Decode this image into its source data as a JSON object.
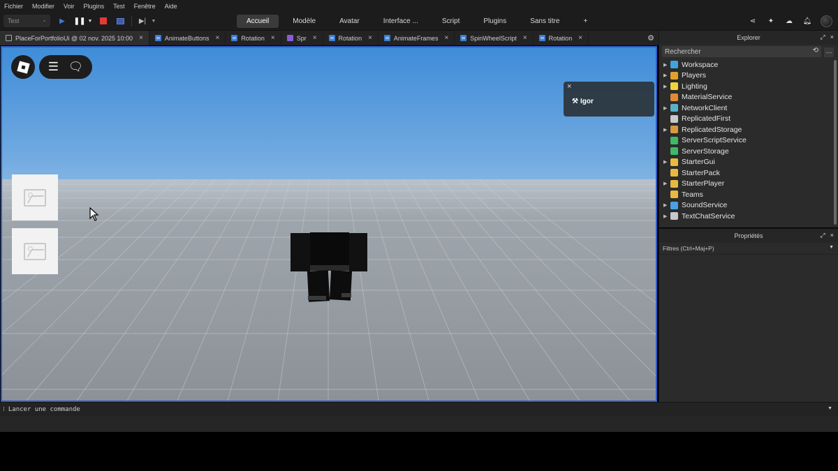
{
  "menubar": [
    "Fichier",
    "Modifier",
    "Voir",
    "Plugins",
    "Test",
    "Fenêtre",
    "Aide"
  ],
  "toolbar": {
    "mode": "Test",
    "tabs": [
      "Accueil",
      "Modèle",
      "Avatar",
      "Interface ...",
      "Script",
      "Plugins",
      "Sans titre",
      "+"
    ],
    "active_tab": "Accueil"
  },
  "doc_tabs": [
    {
      "label": "PlaceForPortfolioUi @ 02 nov. 2025 10:00",
      "icon": "place-icon"
    },
    {
      "label": "AnimateButtons",
      "icon": "script-icon"
    },
    {
      "label": "Rotation",
      "icon": "script-icon"
    },
    {
      "label": "Spr",
      "icon": "localscript-icon"
    },
    {
      "label": "Rotation",
      "icon": "script-icon"
    },
    {
      "label": "AnimateFrames",
      "icon": "script-icon"
    },
    {
      "label": "SpinWheelScript",
      "icon": "script-icon"
    },
    {
      "label": "Rotation",
      "icon": "script-icon"
    }
  ],
  "viewport": {
    "player_list": {
      "player": "Igor"
    }
  },
  "explorer": {
    "title": "Explorer",
    "search_placeholder": "Rechercher",
    "items": [
      {
        "label": "Workspace",
        "expandable": true,
        "color": "#3fa3e0"
      },
      {
        "label": "Players",
        "expandable": true,
        "color": "#e0a030"
      },
      {
        "label": "Lighting",
        "expandable": true,
        "color": "#f2d33a"
      },
      {
        "label": "MaterialService",
        "expandable": false,
        "color": "#e08a3a"
      },
      {
        "label": "NetworkClient",
        "expandable": true,
        "color": "#5ab0c8"
      },
      {
        "label": "ReplicatedFirst",
        "expandable": false,
        "color": "#c8c8c8"
      },
      {
        "label": "ReplicatedStorage",
        "expandable": true,
        "color": "#d89a40"
      },
      {
        "label": "ServerScriptService",
        "expandable": false,
        "color": "#3fb86a"
      },
      {
        "label": "ServerStorage",
        "expandable": false,
        "color": "#3fb86a"
      },
      {
        "label": "StarterGui",
        "expandable": true,
        "color": "#e8b840"
      },
      {
        "label": "StarterPack",
        "expandable": false,
        "color": "#e8b840"
      },
      {
        "label": "StarterPlayer",
        "expandable": true,
        "color": "#e8b840"
      },
      {
        "label": "Teams",
        "expandable": false,
        "color": "#e8b840"
      },
      {
        "label": "SoundService",
        "expandable": true,
        "color": "#4aa0e0"
      },
      {
        "label": "TextChatService",
        "expandable": true,
        "color": "#c8c8c8"
      }
    ]
  },
  "properties": {
    "title": "Propriétés",
    "filter_placeholder": "Filtres (Ctrl+Maj+P)"
  },
  "command_bar": {
    "placeholder": "Lancer une commande"
  },
  "colors": {
    "accent_border": "#2f5dc8",
    "panel_bg": "#2b2b2b",
    "stop_red": "#e53935"
  }
}
